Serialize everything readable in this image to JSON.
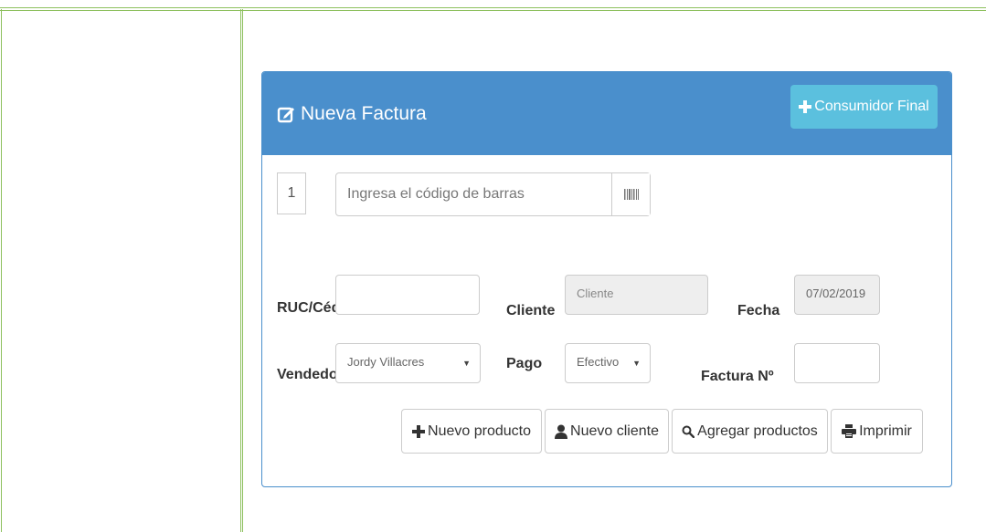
{
  "panel": {
    "title": "Nueva Factura",
    "consumer_button": "Consumidor Final"
  },
  "barcode": {
    "quantity": "1",
    "placeholder": "Ingresa el código de barras"
  },
  "form": {
    "ruc_label": "RUC/Cédu",
    "ruc_value": "",
    "cliente_label": "Cliente",
    "cliente_placeholder": "Cliente",
    "fecha_label": "Fecha",
    "fecha_value": "07/02/2019",
    "vendedor_label": "Vendedor",
    "vendedor_value": "Jordy Villacres",
    "pago_label": "Pago",
    "pago_value": "Efectivo",
    "factura_label": "Factura Nº",
    "factura_value": ""
  },
  "actions": {
    "nuevo_producto": "Nuevo producto",
    "nuevo_cliente": "Nuevo cliente",
    "agregar_productos": "Agregar productos",
    "imprimir": "Imprimir"
  },
  "colors": {
    "accent_border": "#8dc05e",
    "panel_primary": "#4a8fcc",
    "info_button": "#5bc0de"
  },
  "icons": {
    "title": "edit-icon",
    "consumer": "plus-icon",
    "barcode": "barcode-icon",
    "nuevo_producto": "plus-icon",
    "nuevo_cliente": "user-icon",
    "agregar_productos": "search-icon",
    "imprimir": "print-icon"
  }
}
